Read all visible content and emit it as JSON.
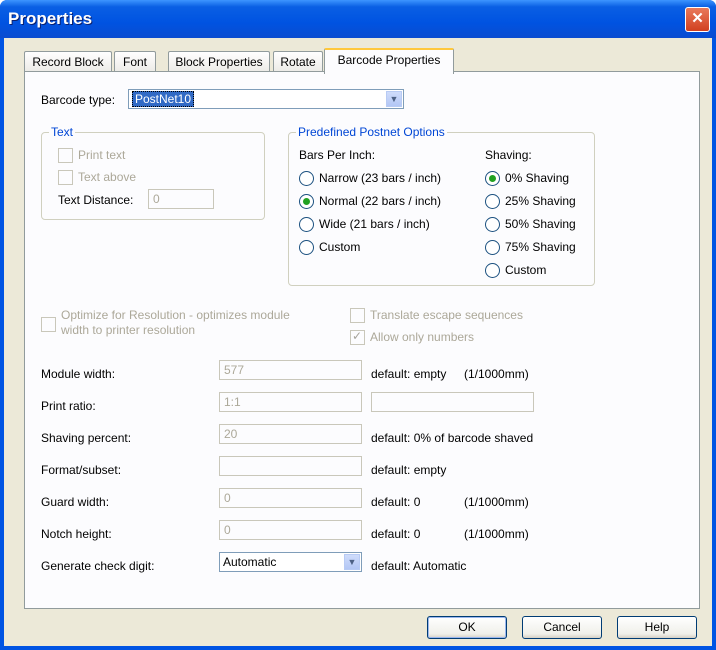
{
  "window": {
    "title": "Properties"
  },
  "tabs": [
    "Record Block",
    "Font",
    "Block Properties",
    "Rotate",
    "Barcode Properties"
  ],
  "barcode_type": {
    "label": "Barcode type:",
    "value": "PostNet10"
  },
  "text_group": {
    "title": "Text",
    "print_text": "Print text",
    "text_above": "Text above",
    "text_distance_label": "Text Distance:",
    "text_distance_value": "0"
  },
  "postnet_group": {
    "title": "Predefined Postnet Options",
    "bars_per_inch_label": "Bars Per Inch:",
    "bars": [
      "Narrow (23 bars / inch)",
      "Normal (22 bars / inch)",
      "Wide (21 bars / inch)",
      "Custom"
    ],
    "bars_selected": "Normal (22 bars / inch)",
    "shaving_label": "Shaving:",
    "shaving": [
      "0% Shaving",
      "25% Shaving",
      "50% Shaving",
      "75% Shaving",
      "Custom"
    ],
    "shaving_selected": "0% Shaving"
  },
  "optimize": {
    "line1": "Optimize for Resolution - optimizes module",
    "line2": "width to printer resolution"
  },
  "translate_escape": "Translate escape sequences",
  "allow_numbers": "Allow only numbers",
  "params": [
    {
      "label": "Module width:",
      "value": "577",
      "default": "default: empty",
      "unit": "(1/1000mm)"
    },
    {
      "label": "Print ratio:",
      "value": "1:1",
      "default": "",
      "unit": ""
    },
    {
      "label": "Shaving percent:",
      "value": "20",
      "default": "default: 0% of barcode shaved",
      "unit": ""
    },
    {
      "label": "Format/subset:",
      "value": "",
      "default": "default: empty",
      "unit": ""
    },
    {
      "label": "Guard width:",
      "value": "0",
      "default": "default: 0",
      "unit": "(1/1000mm)"
    },
    {
      "label": "Notch height:",
      "value": "0",
      "default": "default: 0",
      "unit": "(1/1000mm)"
    }
  ],
  "check_digit": {
    "label": "Generate check digit:",
    "value": "Automatic",
    "default": "default: Automatic"
  },
  "buttons": {
    "ok": "OK",
    "cancel": "Cancel",
    "help": "Help"
  },
  "colors": {
    "titlebar": "#0054e3",
    "dialog_bg": "#ece9d8",
    "group_title": "#0046d5",
    "selection": "#316ac5"
  }
}
